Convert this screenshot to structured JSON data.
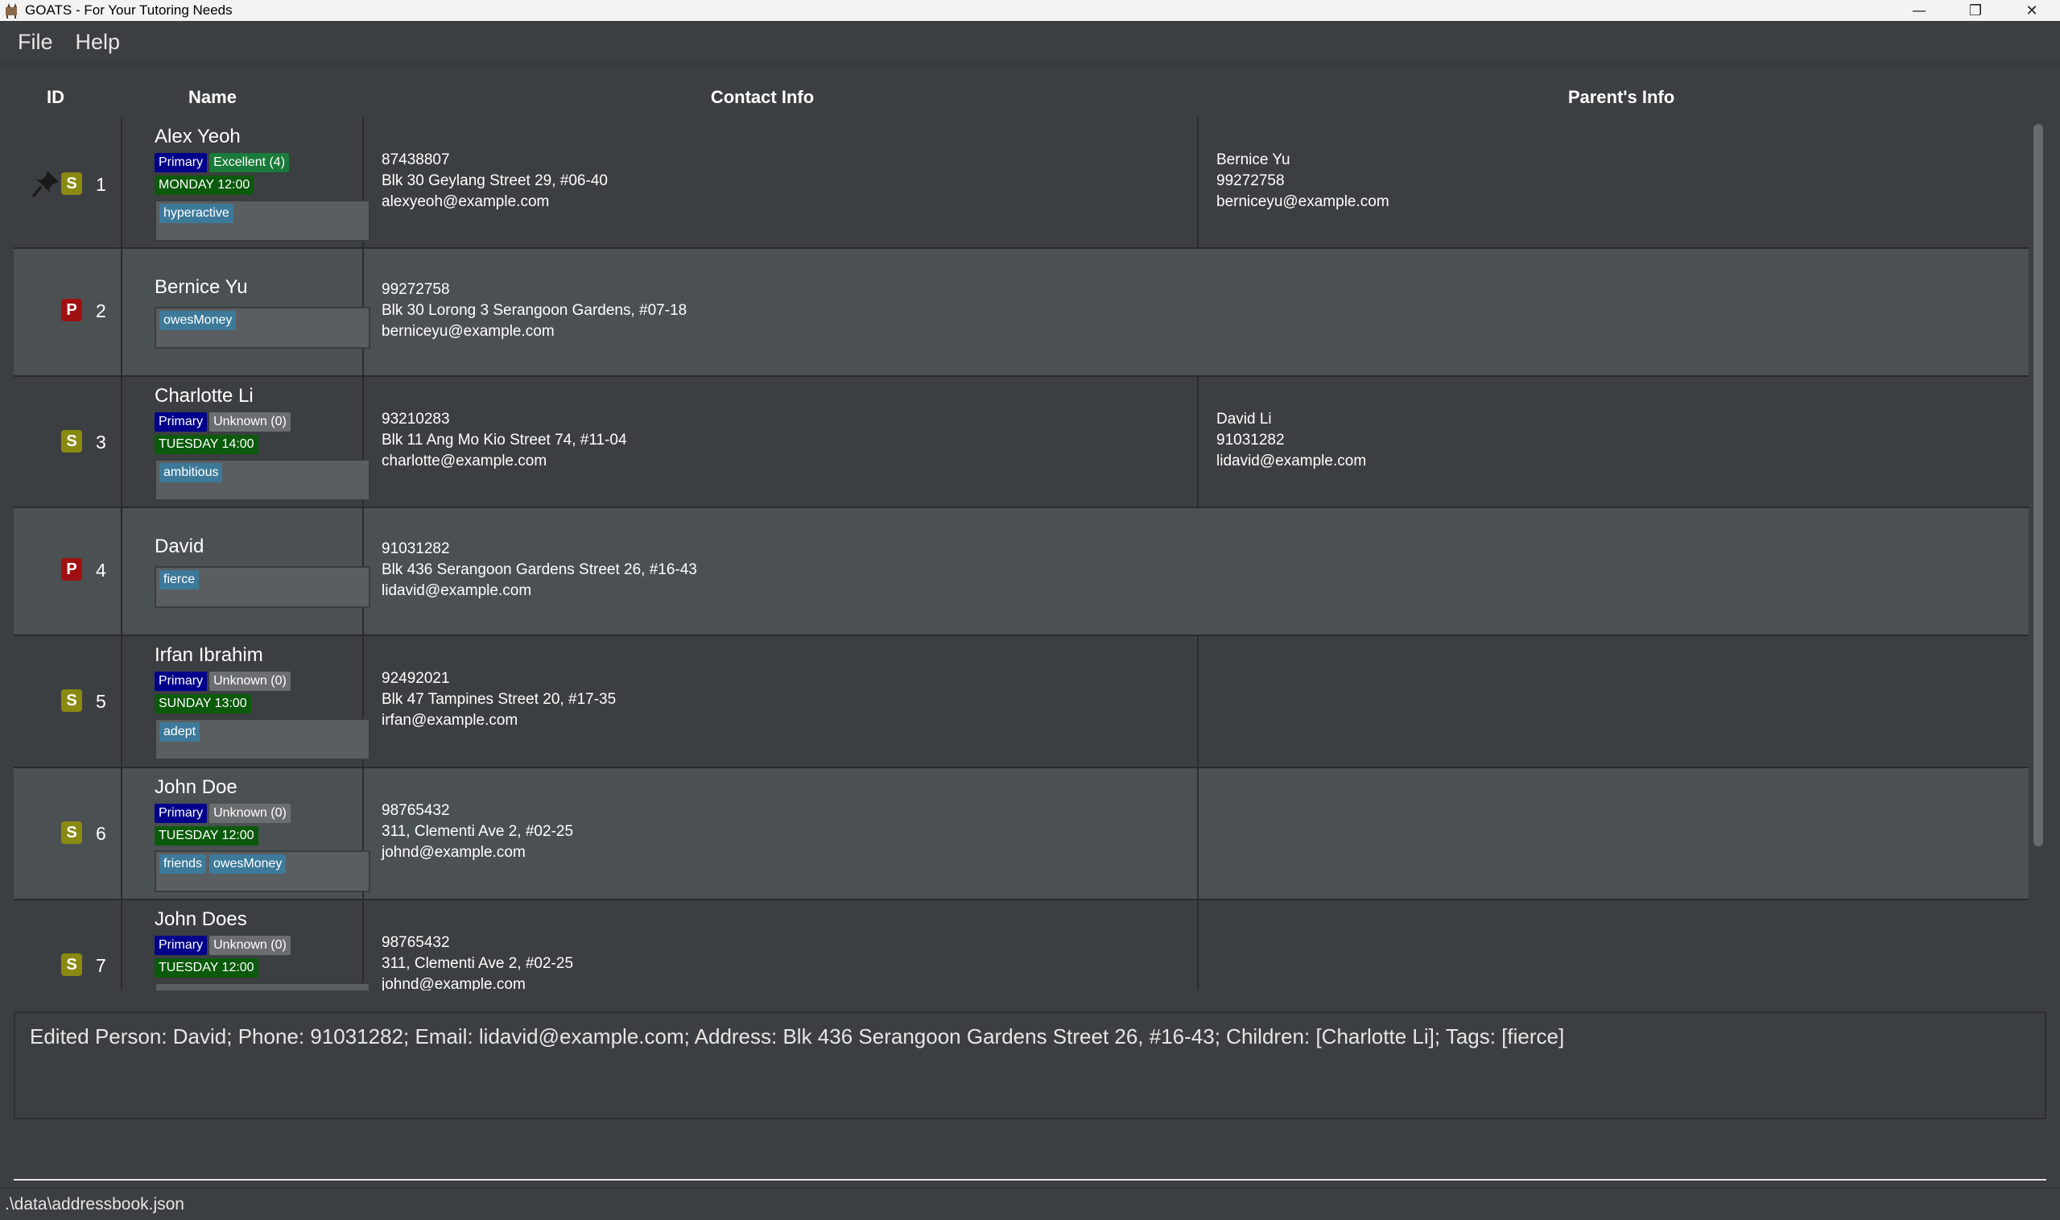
{
  "window": {
    "title": "GOATS - For Your Tutoring Needs",
    "controls": [
      "—",
      "❐",
      "✕"
    ]
  },
  "menu": [
    "File",
    "Help"
  ],
  "columns": {
    "id": "ID",
    "name": "Name",
    "contact": "Contact Info",
    "parent": "Parent's Info"
  },
  "persons": [
    {
      "id": "1",
      "type": "S",
      "pinned": true,
      "name": "Alex Yeoh",
      "level": "Primary",
      "grade": "Excellent (4)",
      "grade_kind": "excellent",
      "lesson": "MONDAY 12:00",
      "tags": [
        "hyperactive"
      ],
      "phone": "87438807",
      "address": "Blk 30 Geylang Street 29, #06-40",
      "email": "alexyeoh@example.com",
      "parent_name": "Bernice Yu",
      "parent_phone": "99272758",
      "parent_email": "berniceyu@example.com"
    },
    {
      "id": "2",
      "type": "P",
      "pinned": false,
      "name": "Bernice Yu",
      "tags": [
        "owesMoney"
      ],
      "phone": "99272758",
      "address": "Blk 30 Lorong 3 Serangoon Gardens, #07-18",
      "email": "berniceyu@example.com"
    },
    {
      "id": "3",
      "type": "S",
      "pinned": false,
      "name": "Charlotte Li",
      "level": "Primary",
      "grade": "Unknown (0)",
      "grade_kind": "unknown",
      "lesson": "TUESDAY 14:00",
      "tags": [
        "ambitious"
      ],
      "phone": "93210283",
      "address": "Blk 11 Ang Mo Kio Street 74, #11-04",
      "email": "charlotte@example.com",
      "parent_name": "David Li",
      "parent_phone": "91031282",
      "parent_email": "lidavid@example.com"
    },
    {
      "id": "4",
      "type": "P",
      "pinned": false,
      "name": "David",
      "tags": [
        "fierce"
      ],
      "phone": "91031282",
      "address": "Blk 436 Serangoon Gardens Street 26, #16-43",
      "email": "lidavid@example.com"
    },
    {
      "id": "5",
      "type": "S",
      "pinned": false,
      "name": "Irfan Ibrahim",
      "level": "Primary",
      "grade": "Unknown (0)",
      "grade_kind": "unknown",
      "lesson": "SUNDAY 13:00",
      "tags": [
        "adept"
      ],
      "phone": "92492021",
      "address": "Blk 47 Tampines Street 20, #17-35",
      "email": "irfan@example.com"
    },
    {
      "id": "6",
      "type": "S",
      "pinned": false,
      "name": "John Doe",
      "level": "Primary",
      "grade": "Unknown (0)",
      "grade_kind": "unknown",
      "lesson": "TUESDAY 12:00",
      "tags": [
        "friends",
        "owesMoney"
      ],
      "phone": "98765432",
      "address": "311, Clementi Ave 2, #02-25",
      "email": "johnd@example.com"
    },
    {
      "id": "7",
      "type": "S",
      "pinned": false,
      "name": "John Does",
      "level": "Primary",
      "grade": "Unknown (0)",
      "grade_kind": "unknown",
      "lesson": "TUESDAY 12:00",
      "tags": [],
      "phone": "98765432",
      "address": "311, Clementi Ave 2, #02-25",
      "email": "johnd@example.com"
    }
  ],
  "result": "Edited Person: David; Phone: 91031282; Email: lidavid@example.com; Address: Blk 436 Serangoon Gardens Street 26, #16-43; Children: [Charlotte Li]; Tags: [fierce]",
  "command": {
    "value": ""
  },
  "status": ".\\data\\addressbook.json",
  "colors": {
    "background": "#3c3f41",
    "row_alt": "#4b5053",
    "student_badge": "#8a8a12",
    "parent_badge": "#a01010",
    "level_chip": "#00008b",
    "grade_excellent": "#1a7a3a",
    "grade_unknown": "#6b6e70",
    "lesson_chip": "#0b5a0b",
    "tag_chip": "#3d7a9a"
  },
  "icons": {
    "app": "goat-icon",
    "pin": "pin-icon"
  }
}
